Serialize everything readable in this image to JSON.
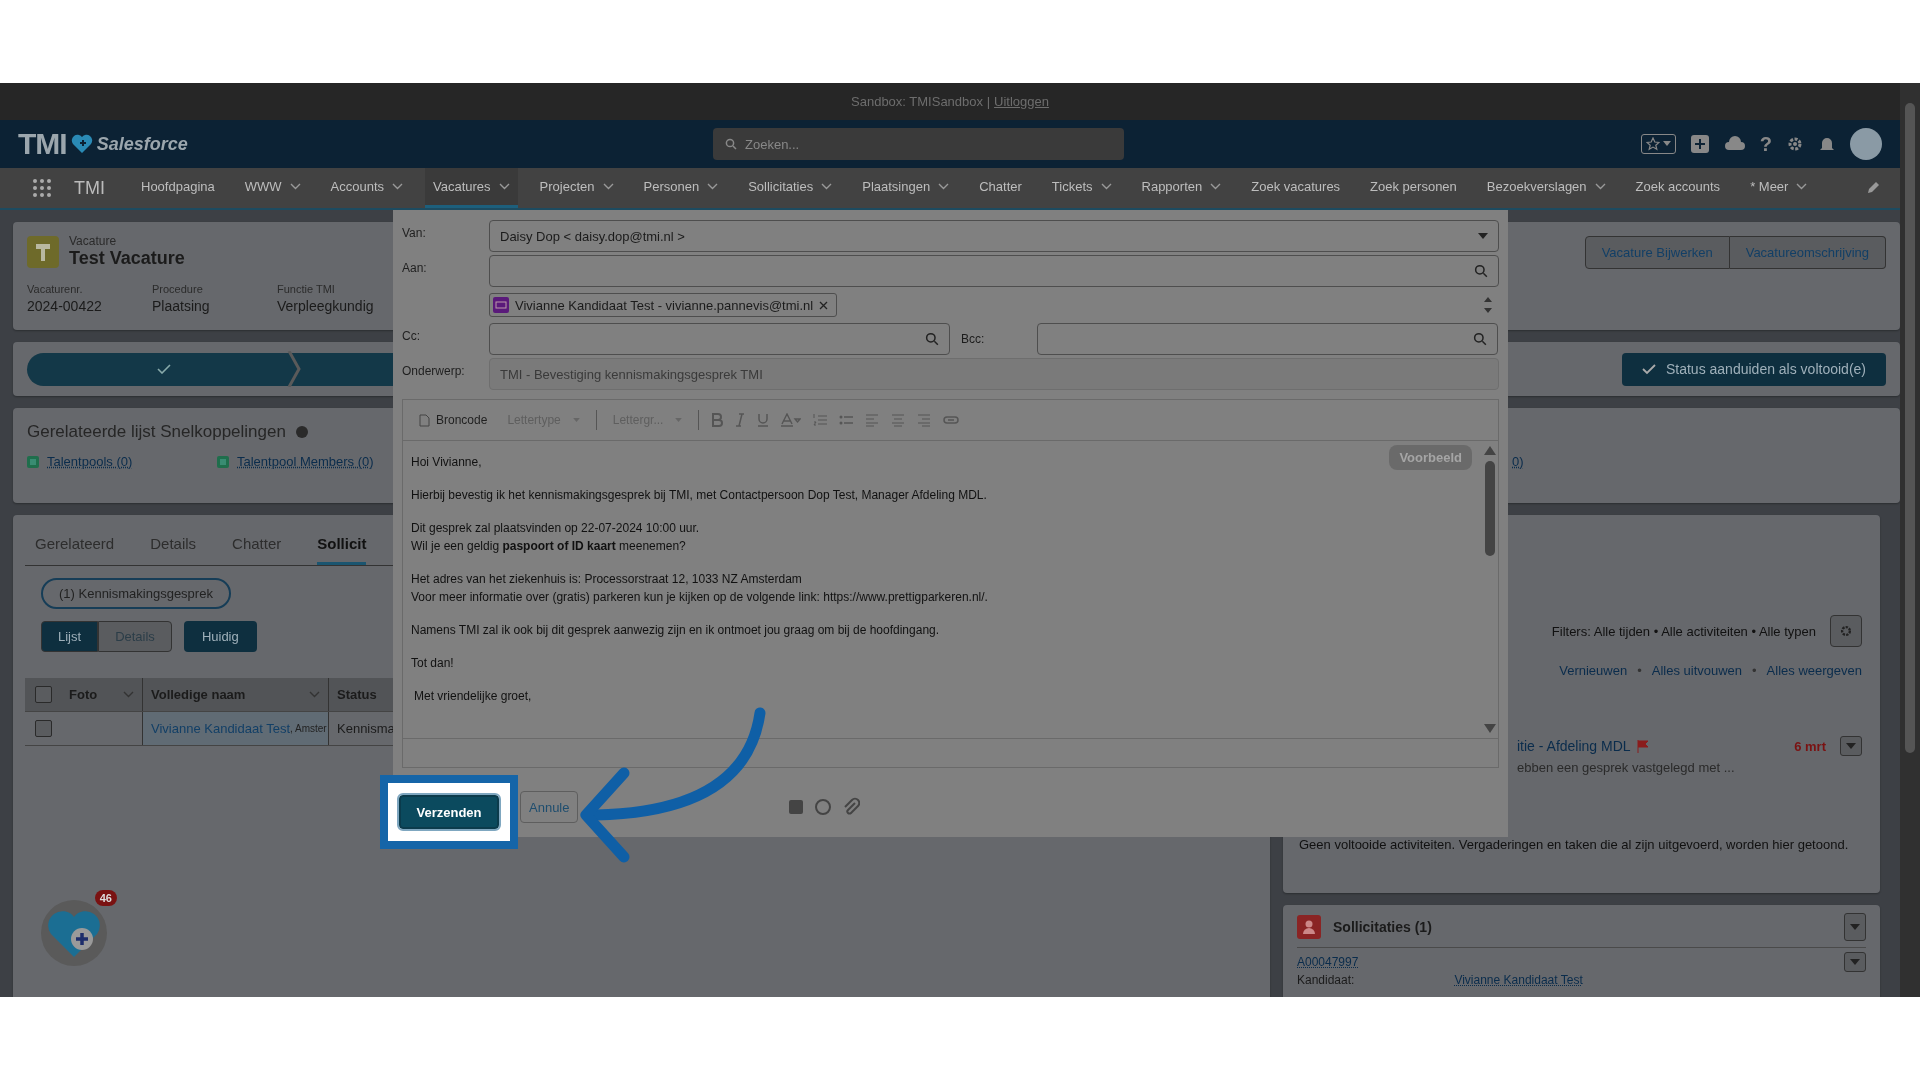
{
  "top_banner": {
    "text": "Sandbox: TMISandbox |",
    "link": "Uitloggen"
  },
  "header": {
    "logo": "TMI",
    "brand": "Salesforce",
    "search_placeholder": "Zoeken...",
    "help_glyph": "?"
  },
  "nav": {
    "app_name": "TMI",
    "items": [
      {
        "label": "Hoofdpagina",
        "dropdown": false,
        "selected": false
      },
      {
        "label": "WWW",
        "dropdown": true,
        "selected": false
      },
      {
        "label": "Accounts",
        "dropdown": true,
        "selected": false
      },
      {
        "label": "Vacatures",
        "dropdown": true,
        "selected": true
      },
      {
        "label": "Projecten",
        "dropdown": true,
        "selected": false
      },
      {
        "label": "Personen",
        "dropdown": true,
        "selected": false
      },
      {
        "label": "Sollicitaties",
        "dropdown": true,
        "selected": false
      },
      {
        "label": "Plaatsingen",
        "dropdown": true,
        "selected": false
      },
      {
        "label": "Chatter",
        "dropdown": false,
        "selected": false
      },
      {
        "label": "Tickets",
        "dropdown": true,
        "selected": false
      },
      {
        "label": "Rapporten",
        "dropdown": true,
        "selected": false
      },
      {
        "label": "Zoek vacatures",
        "dropdown": false,
        "selected": false
      },
      {
        "label": "Zoek personen",
        "dropdown": false,
        "selected": false
      },
      {
        "label": "Bezoekverslagen",
        "dropdown": true,
        "selected": false
      },
      {
        "label": "Zoek accounts",
        "dropdown": false,
        "selected": false
      },
      {
        "label": "* Meer",
        "dropdown": true,
        "selected": false
      }
    ]
  },
  "record": {
    "type": "Vacature",
    "title": "Test Vacature",
    "fields": [
      {
        "label": "Vacaturenr.",
        "value": "2024-00422"
      },
      {
        "label": "Procedure",
        "value": "Plaatsing"
      },
      {
        "label": "Functie TMI",
        "value": "Verpleegkundig"
      }
    ],
    "actions": [
      "Vacature Bijwerken",
      "Vacatureomschrijving"
    ]
  },
  "path": {
    "status_button": "Status aanduiden als voltooid(e)"
  },
  "quicklinks": {
    "title": "Gerelateerde lijst Snelkoppelingen",
    "links": [
      "Talentpools (0)",
      "Talentpool Members (0)"
    ],
    "cut_link": "0)"
  },
  "tabs": [
    {
      "label": "Gerelateerd",
      "selected": false
    },
    {
      "label": "Details",
      "selected": false
    },
    {
      "label": "Chatter",
      "selected": false
    },
    {
      "label": "Sollicit",
      "selected": true
    }
  ],
  "filter_chip": "(1) Kennismakingsgesprek",
  "view_toggle": [
    {
      "label": "Lijst",
      "selected": true
    },
    {
      "label": "Details",
      "selected": false
    }
  ],
  "current_button": "Huidig",
  "table": {
    "all_checked": false,
    "columns": [
      "Foto",
      "Volledige naam",
      "Status"
    ],
    "rows": [
      {
        "checked": false,
        "name": "Vivianne Kandidaat Test",
        "place": ", Amster",
        "status": "Kennisma"
      }
    ]
  },
  "help_badge": {
    "count": "46"
  },
  "activity": {
    "filters": "Filters: Alle tijden • Alle activiteiten • Alle typen",
    "links": [
      "Vernieuwen",
      "Alles uitvouwen",
      "Alles weergeven"
    ],
    "separator": "•",
    "item": {
      "title": "itie - Afdeling MDL",
      "date": "6 mrt",
      "snippet": "ebben een gesprek vastgelegd met ..."
    },
    "empty_text": "Geen voltooide activiteiten. Vergaderingen en taken die al zijn uitgevoerd, worden hier getoond."
  },
  "applications": {
    "title": "Sollicitaties (1)",
    "record": "A00047997",
    "label": "Kandidaat:",
    "value": "Vivianne Kandidaat Test"
  },
  "email": {
    "from_label": "Van:",
    "from_value": "Daisy Dop < daisy.dop@tmi.nl >",
    "to_label": "Aan:",
    "recipients": [
      "Vivianne Kandidaat Test - vivianne.pannevis@tmi.nl"
    ],
    "cc_label": "Cc:",
    "bcc_label": "Bcc:",
    "subject_label": "Onderwerp:",
    "subject_value": "TMI - Bevestiging kennismakingsgesprek TMI",
    "toolbar": {
      "source": "Broncode",
      "font": "Lettertype",
      "size": "Lettergr..."
    },
    "preview_badge": "Voorbeeld",
    "body": [
      [
        "Hoi Vivianne,"
      ],
      [
        "Hierbij bevestig ik het kennismakingsgesprek bij TMI, met Contactpersoon Dop Test, Manager Afdeling MDL."
      ],
      [
        "Dit gesprek zal plaatsvinden op 22-07-2024 10:00 uur.",
        "Wil je een geldig **paspoort of ID kaart** meenemen?"
      ],
      [
        "Het adres van het ziekenhuis is: Processorstraat 12, 1033 NZ Amsterdam",
        "Voor meer informatie over (gratis) parkeren kun je kijken op de volgende link: https://www.prettigparkeren.nl/."
      ],
      [
        "Namens TMI zal ik ook bij dit gesprek aanwezig zijn en ik ontmoet jou graag om bij de hoofdingang."
      ],
      [
        "Tot dan!"
      ],
      [
        "Met vriendelijke groet,"
      ]
    ],
    "send_button": "Verzenden",
    "cancel_button": "Annule"
  }
}
